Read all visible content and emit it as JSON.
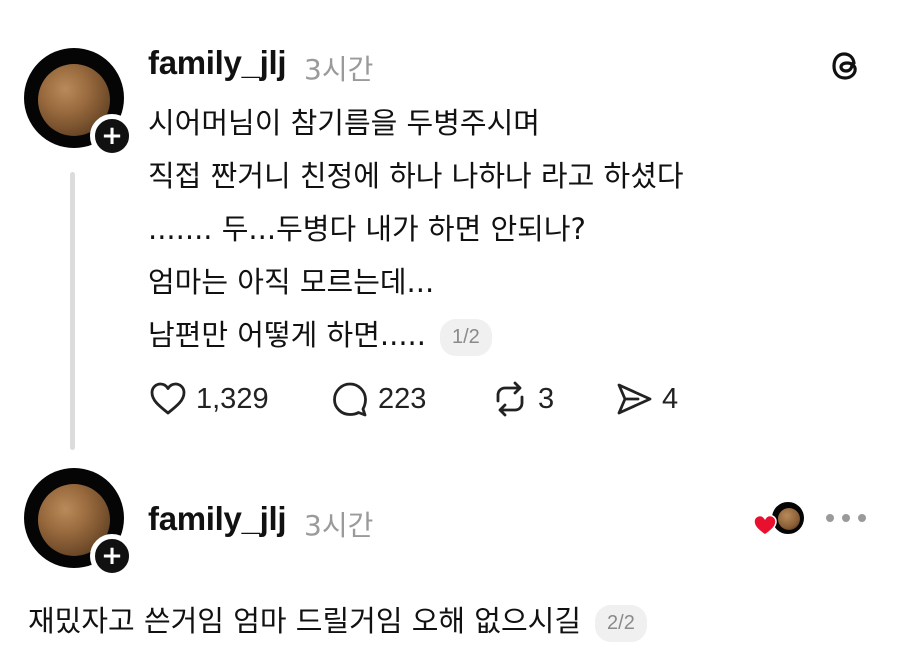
{
  "post": {
    "username": "family_jlj",
    "time": "3시간",
    "lines": [
      "시어머님이 참기름을 두병주시며",
      "직접 짠거니 친정에 하나 나하나 라고 하셨다",
      "....... 두...두병다 내가 하면 안되나?",
      "엄마는 아직 모르는데...",
      "남편만 어떻게 하면....."
    ],
    "pager": "1/2",
    "actions": {
      "likes": "1,329",
      "comments": "223",
      "reposts": "3",
      "shares": "4"
    }
  },
  "reply": {
    "username": "family_jlj",
    "time": "3시간",
    "text": "재밌자고 쓴거임 엄마 드릴거임 오해 없으시길",
    "pager": "2/2"
  },
  "icons": [
    "threads-logo-icon",
    "plus-icon",
    "heart-icon",
    "comment-icon",
    "repost-icon",
    "share-icon",
    "more-icon"
  ],
  "colors": {
    "text": "#111111",
    "muted": "#9a9a9a",
    "like_red": "#e8102e"
  }
}
